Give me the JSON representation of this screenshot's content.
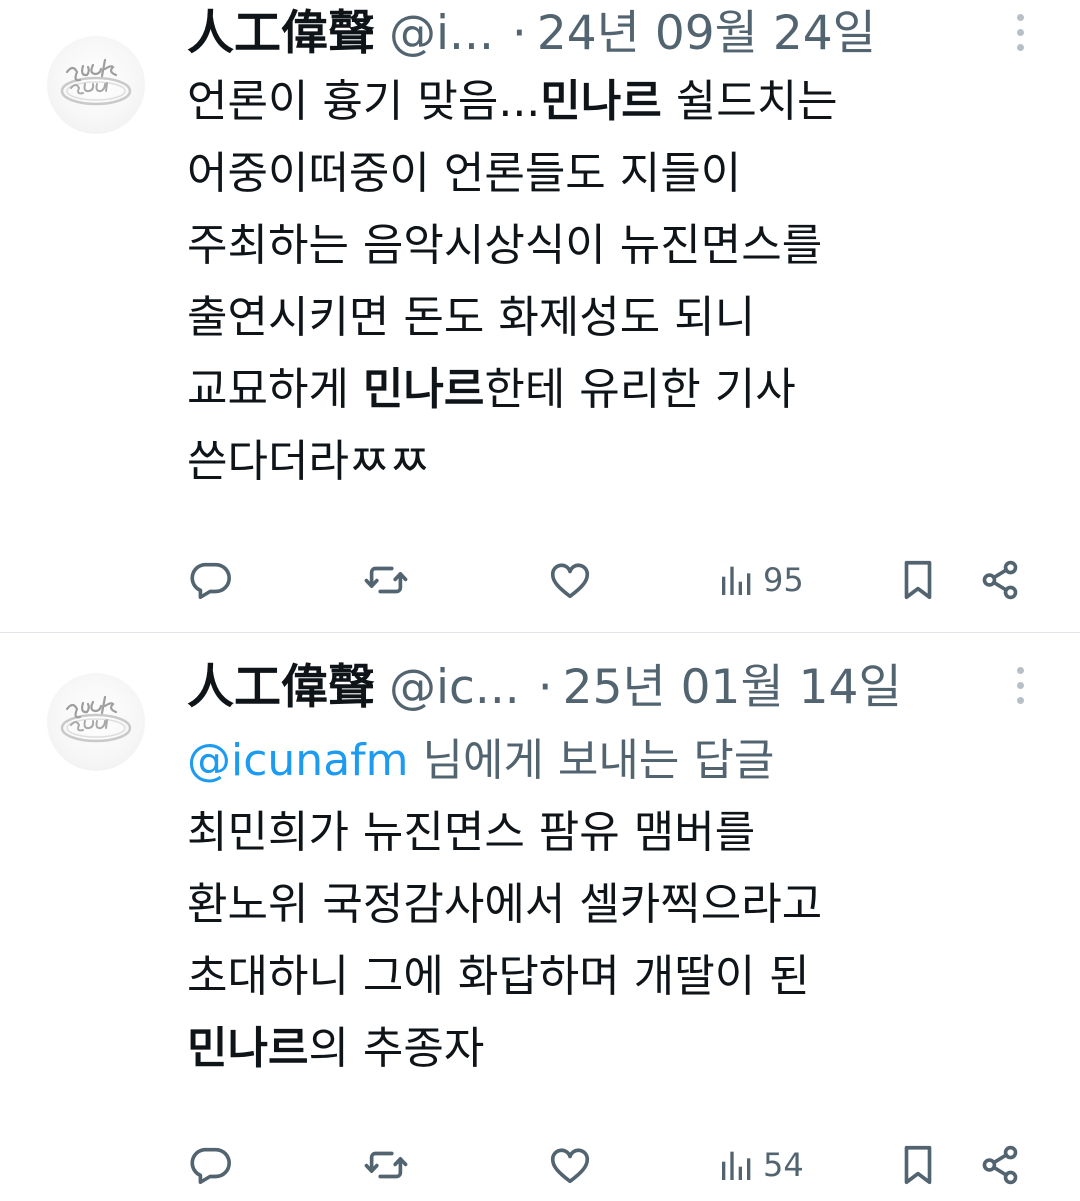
{
  "tweets": [
    {
      "display_name": "人工偉聲",
      "handle": "@i...",
      "separator": "·",
      "date": "24년 09월 24일",
      "body_lines": [
        [
          {
            "text": "언론이 흉기 맞음...",
            "bold": false
          },
          {
            "text": "민나르",
            "bold": true
          },
          {
            "text": " 쉴드치는",
            "bold": false
          }
        ],
        [
          {
            "text": "어중이떠중이 언론들도 지들이",
            "bold": false
          }
        ],
        [
          {
            "text": "주최하는 음악시상식이 뉴진면스를",
            "bold": false
          }
        ],
        [
          {
            "text": "출연시키면 돈도 화제성도 되니",
            "bold": false
          }
        ],
        [
          {
            "text": "교묘하게 ",
            "bold": false
          },
          {
            "text": "민나르",
            "bold": true
          },
          {
            "text": "한테 유리한 기사",
            "bold": false
          }
        ],
        [
          {
            "text": "쓴다더라ㅉㅉ",
            "bold": false
          }
        ]
      ],
      "views": "95",
      "avatar_icon": "ring-avatar-icon"
    },
    {
      "display_name": "人工偉聲",
      "handle": "@ic...",
      "separator": "·",
      "date": "25년 01월 14일",
      "reply_to": {
        "mention": "@icunafm",
        "suffix": " 님에게 보내는 답글"
      },
      "body_lines": [
        [
          {
            "text": "최민희가 뉴진면스 팜유 맴버를",
            "bold": false
          }
        ],
        [
          {
            "text": "환노위 국정감사에서 셀카찍으라고",
            "bold": false
          }
        ],
        [
          {
            "text": "초대하니 그에 화답하며 개딸이 된",
            "bold": false
          }
        ],
        [
          {
            "text": "민나르",
            "bold": true
          },
          {
            "text": "의 추종자",
            "bold": false
          }
        ]
      ],
      "views": "54",
      "avatar_icon": "ring-avatar-icon"
    }
  ],
  "icons": {
    "reply": "reply-icon",
    "retweet": "retweet-icon",
    "like": "heart-icon",
    "views": "views-chart-icon",
    "bookmark": "bookmark-icon",
    "share": "share-icon",
    "more": "more-vertical-icon"
  },
  "colors": {
    "text_primary": "#0f1419",
    "text_secondary": "#536471",
    "mention": "#1d9bf0",
    "icon": "#536471",
    "divider": "#e1e5e9"
  }
}
